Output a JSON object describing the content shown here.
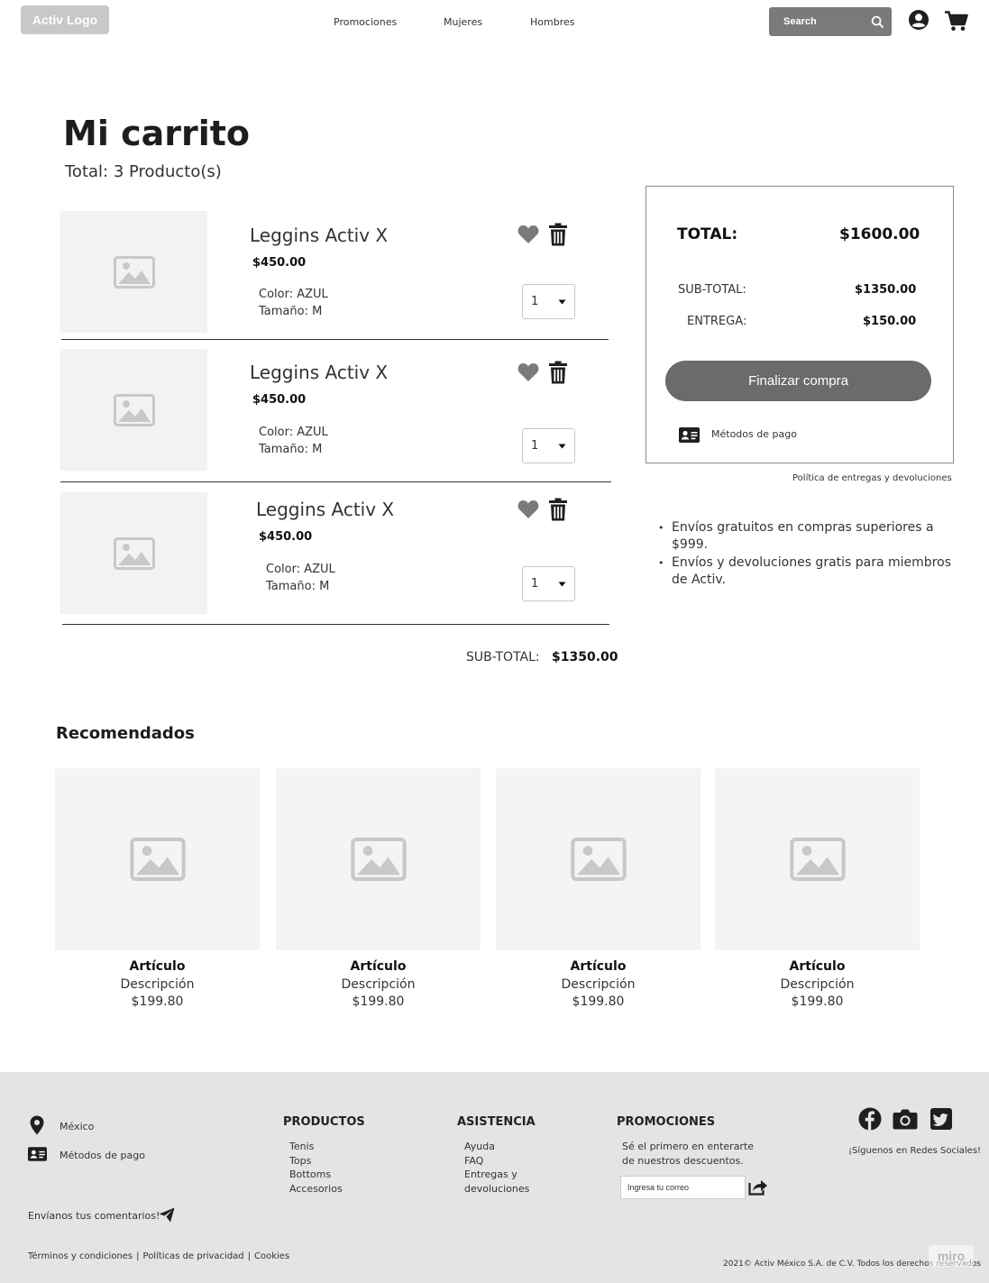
{
  "header": {
    "logo": "Activ Logo",
    "nav": [
      "Promociones",
      "Mujeres",
      "Hombres"
    ],
    "search_placeholder": "Search"
  },
  "cart": {
    "title": "Mi carrito",
    "total_count": "Total: 3 Producto(s)",
    "items": [
      {
        "name": "Leggins Activ X",
        "price": "$450.00",
        "color": "Color: AZUL",
        "size": "Tamaño: M",
        "qty": "1"
      },
      {
        "name": "Leggins Activ X",
        "price": "$450.00",
        "color": "Color: AZUL",
        "size": "Tamaño: M",
        "qty": "1"
      },
      {
        "name": "Leggins Activ X",
        "price": "$450.00",
        "color": "Color: AZUL",
        "size": "Tamaño: M",
        "qty": "1"
      }
    ],
    "subtotal_label": "SUB-TOTAL:",
    "subtotal_value": "$1350.00"
  },
  "summary": {
    "total_label": "TOTAL:",
    "total_value": "$1600.00",
    "subtotal_label": "SUB-TOTAL:",
    "subtotal_value": "$1350.00",
    "delivery_label": "ENTREGA:",
    "delivery_value": "$150.00",
    "checkout_label": "Finalizar compra",
    "payment_methods": "Métodos de pago",
    "policy_link": "Política de entregas y devoluciones",
    "bullets": [
      "Envíos gratuitos en compras superiores a $999.",
      "Envíos y devoluciones gratis para miembros de Activ."
    ]
  },
  "recommended": {
    "title": "Recomendados",
    "items": [
      {
        "name": "Artículo",
        "desc": "Descripción",
        "price": "$199.80"
      },
      {
        "name": "Artículo",
        "desc": "Descripción",
        "price": "$199.80"
      },
      {
        "name": "Artículo",
        "desc": "Descripción",
        "price": "$199.80"
      },
      {
        "name": "Artículo",
        "desc": "Descripción",
        "price": "$199.80"
      }
    ]
  },
  "footer": {
    "location": "México",
    "payment": "Métodos de pago",
    "feedback": "Envíanos tus comentarios!",
    "productos": {
      "title": "PRODUCTOS",
      "items": [
        "Tenis",
        "Tops",
        "Bottoms",
        "Accesorios"
      ]
    },
    "asistencia": {
      "title": "ASISTENCIA",
      "items": [
        "Ayuda",
        "FAQ",
        "Entregas y",
        "devoluciones"
      ]
    },
    "promociones": {
      "title": "PROMOCIONES",
      "text1": "Sé el primero en enterarte",
      "text2": "de nuestros descuentos.",
      "email_placeholder": "Ingresa tu correo"
    },
    "social": "¡Síguenos en Redes Sociales!",
    "legal_links": [
      "Términos y condiciones",
      "Políticas de privacidad",
      "Cookies"
    ],
    "copyright": "2021© Activ México S.A. de C.V. Todos los derechos reservados",
    "watermark": "miro"
  },
  "colors": {
    "accent_dark": "#6b6b6b",
    "placeholder_bg": "#f2f2f2",
    "footer_bg": "#e4e4e4"
  }
}
